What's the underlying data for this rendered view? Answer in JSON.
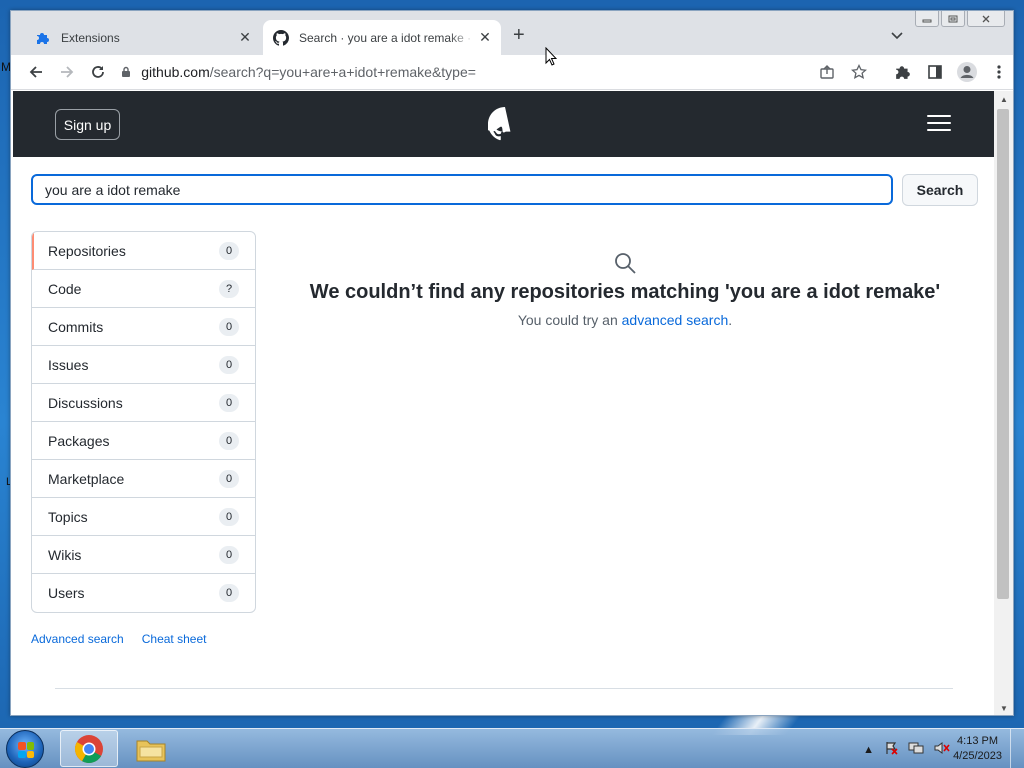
{
  "browser": {
    "tabs": [
      {
        "title": "Extensions",
        "icon": "puzzle-icon",
        "active": false
      },
      {
        "title": "Search · you are a idot remake · GitHub",
        "icon": "github-icon",
        "active": true
      }
    ],
    "new_tab": "+",
    "tab_close": "✕",
    "url_host": "github.com",
    "url_rest": "/search?q=you+are+a+idot+remake&type="
  },
  "page": {
    "header": {
      "signup_label": "Sign up"
    },
    "search": {
      "value": "you are a idot remake",
      "button_label": "Search"
    },
    "facets": [
      {
        "label": "Repositories",
        "count": "0",
        "active": true
      },
      {
        "label": "Code",
        "count": "?",
        "active": false
      },
      {
        "label": "Commits",
        "count": "0",
        "active": false
      },
      {
        "label": "Issues",
        "count": "0",
        "active": false
      },
      {
        "label": "Discussions",
        "count": "0",
        "active": false
      },
      {
        "label": "Packages",
        "count": "0",
        "active": false
      },
      {
        "label": "Marketplace",
        "count": "0",
        "active": false
      },
      {
        "label": "Topics",
        "count": "0",
        "active": false
      },
      {
        "label": "Wikis",
        "count": "0",
        "active": false
      },
      {
        "label": "Users",
        "count": "0",
        "active": false
      }
    ],
    "side_links": {
      "advanced": "Advanced search",
      "cheat": "Cheat sheet"
    },
    "empty_state": {
      "heading": "We couldn’t find any repositories matching 'you are a idot remake'",
      "prefix": "You could try an ",
      "link": "advanced search",
      "suffix": "."
    }
  },
  "desktop": {
    "letter_top": "M",
    "letter_mid": "L"
  },
  "taskbar": {
    "time": "4:13 PM",
    "date": "4/25/2023"
  },
  "colors": {
    "header_bg": "#24292f",
    "link": "#0969da",
    "active_facet": "#fd8c73",
    "focus_border": "#0969da"
  }
}
